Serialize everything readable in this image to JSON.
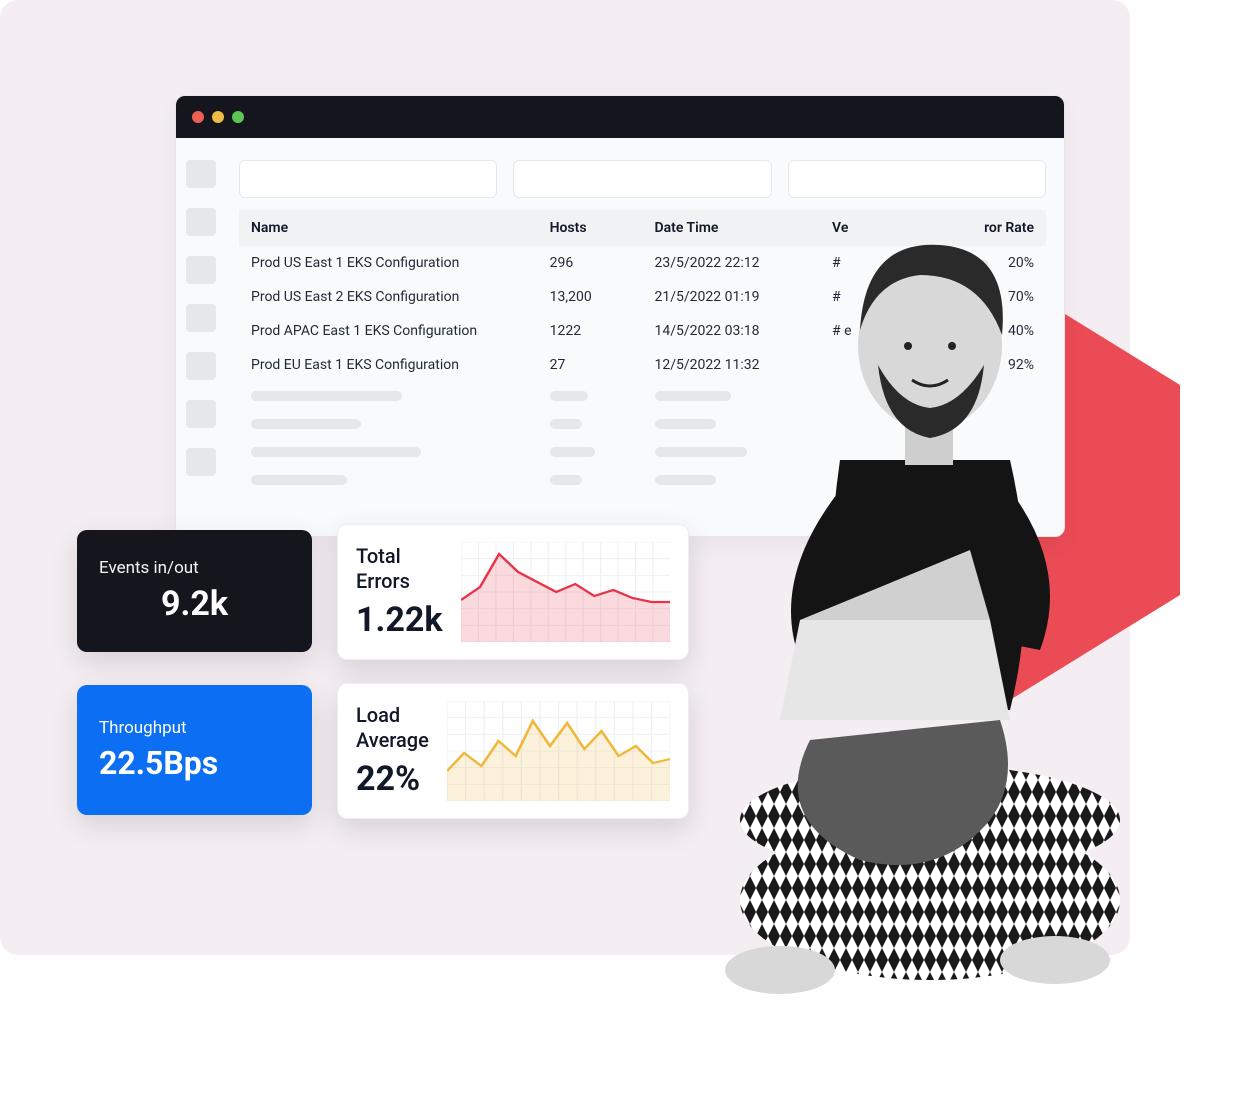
{
  "table": {
    "headers": {
      "name": "Name",
      "hosts": "Hosts",
      "datetime": "Date Time",
      "version": "Ve",
      "error_rate": "ror Rate"
    },
    "rows": [
      {
        "name": "Prod US East 1 EKS Configuration",
        "hosts": "296",
        "datetime": "23/5/2022  22:12",
        "version": "#",
        "error_rate_pct": 20,
        "error_rate_label": "20%",
        "bar_color": "#f178a0"
      },
      {
        "name": "Prod US East 2 EKS Configuration",
        "hosts": "13,200",
        "datetime": "21/5/2022  01:19",
        "version": "#",
        "error_rate_pct": 70,
        "error_rate_label": "70%",
        "bar_color": "#8691a6"
      },
      {
        "name": "Prod APAC East 1 EKS Configuration",
        "hosts": "1222",
        "datetime": "14/5/2022  03:18",
        "version": "# e",
        "error_rate_pct": 40,
        "error_rate_label": "40%",
        "bar_color": "#a5b0c2"
      },
      {
        "name": "Prod EU East 1 EKS Configuration",
        "hosts": "27",
        "datetime": "12/5/2022  11:32",
        "version": "",
        "error_rate_pct": 92,
        "error_rate_label": "92%",
        "bar_color": "#6b7688"
      }
    ]
  },
  "metrics": {
    "events": {
      "label": "Events in/out",
      "value": "9.2k"
    },
    "throughput": {
      "label": "Throughput",
      "value": "22.5Bps"
    },
    "total_errors": {
      "label": "Total\nErrors",
      "value": "1.22k"
    },
    "load_avg": {
      "label": "Load\nAverage",
      "value": "22%"
    }
  },
  "chart_data": [
    {
      "type": "area",
      "name": "Total Errors sparkline",
      "color": "#e8344a",
      "x": [
        0,
        1,
        2,
        3,
        4,
        5,
        6,
        7,
        8,
        9,
        10,
        11
      ],
      "values": [
        42,
        55,
        88,
        70,
        60,
        50,
        58,
        46,
        52,
        44,
        40,
        40
      ],
      "ylim": [
        0,
        100
      ]
    },
    {
      "type": "area",
      "name": "Load Average sparkline",
      "color": "#f0b83b",
      "x": [
        0,
        1,
        2,
        3,
        4,
        5,
        6,
        7,
        8,
        9,
        10,
        11,
        12,
        13
      ],
      "values": [
        30,
        48,
        35,
        60,
        45,
        80,
        55,
        78,
        52,
        70,
        45,
        55,
        38,
        42
      ],
      "ylim": [
        0,
        100
      ]
    }
  ]
}
